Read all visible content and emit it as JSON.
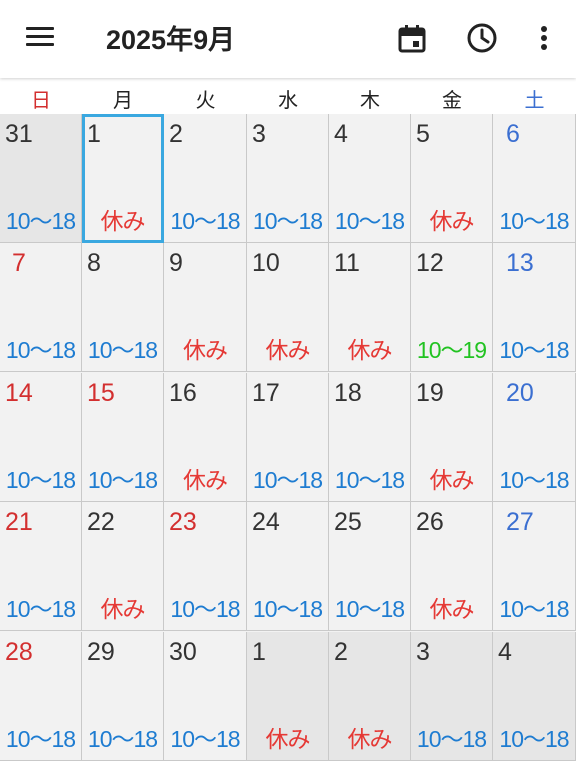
{
  "header": {
    "title": "2025年9月",
    "menu_icon": "hamburger-menu-icon",
    "actions": [
      "calendar-icon",
      "clock-icon",
      "more-vert-icon"
    ]
  },
  "weekdays": [
    "日",
    "月",
    "火",
    "水",
    "木",
    "金",
    "土"
  ],
  "colors": {
    "sunday": "#d32f2f",
    "saturday": "#3b6fd1",
    "work": "#1e7cd1",
    "holiday_text": "#e53935",
    "special": "#22c322",
    "default_day": "#333333",
    "other_month_bg": "#e6e6e6",
    "selected_border": "#3aa8e0"
  },
  "weeks": [
    [
      {
        "day": "31",
        "sched": "10〜18",
        "type": "work",
        "other": true
      },
      {
        "day": "1",
        "sched": "休み",
        "type": "off",
        "selected": true
      },
      {
        "day": "2",
        "sched": "10〜18",
        "type": "work"
      },
      {
        "day": "3",
        "sched": "10〜18",
        "type": "work"
      },
      {
        "day": "4",
        "sched": "10〜18",
        "type": "work"
      },
      {
        "day": "5",
        "sched": "休み",
        "type": "off"
      },
      {
        "day": "6",
        "sched": "10〜18",
        "type": "work"
      }
    ],
    [
      {
        "day": "7",
        "sched": "10〜18",
        "type": "work"
      },
      {
        "day": "8",
        "sched": "10〜18",
        "type": "work"
      },
      {
        "day": "9",
        "sched": "休み",
        "type": "off"
      },
      {
        "day": "10",
        "sched": "休み",
        "type": "off"
      },
      {
        "day": "11",
        "sched": "休み",
        "type": "off"
      },
      {
        "day": "12",
        "sched": "10〜19",
        "type": "special"
      },
      {
        "day": "13",
        "sched": "10〜18",
        "type": "work"
      }
    ],
    [
      {
        "day": "14",
        "sched": "10〜18",
        "type": "work"
      },
      {
        "day": "15",
        "sched": "10〜18",
        "type": "work",
        "holiday": true
      },
      {
        "day": "16",
        "sched": "休み",
        "type": "off"
      },
      {
        "day": "17",
        "sched": "10〜18",
        "type": "work"
      },
      {
        "day": "18",
        "sched": "10〜18",
        "type": "work"
      },
      {
        "day": "19",
        "sched": "休み",
        "type": "off"
      },
      {
        "day": "20",
        "sched": "10〜18",
        "type": "work"
      }
    ],
    [
      {
        "day": "21",
        "sched": "10〜18",
        "type": "work"
      },
      {
        "day": "22",
        "sched": "休み",
        "type": "off"
      },
      {
        "day": "23",
        "sched": "10〜18",
        "type": "work",
        "holiday": true
      },
      {
        "day": "24",
        "sched": "10〜18",
        "type": "work"
      },
      {
        "day": "25",
        "sched": "10〜18",
        "type": "work"
      },
      {
        "day": "26",
        "sched": "休み",
        "type": "off"
      },
      {
        "day": "27",
        "sched": "10〜18",
        "type": "work"
      }
    ],
    [
      {
        "day": "28",
        "sched": "10〜18",
        "type": "work"
      },
      {
        "day": "29",
        "sched": "10〜18",
        "type": "work"
      },
      {
        "day": "30",
        "sched": "10〜18",
        "type": "work"
      },
      {
        "day": "1",
        "sched": "休み",
        "type": "off",
        "other": true
      },
      {
        "day": "2",
        "sched": "休み",
        "type": "off",
        "other": true
      },
      {
        "day": "3",
        "sched": "10〜18",
        "type": "work",
        "other": true
      },
      {
        "day": "4",
        "sched": "10〜18",
        "type": "work",
        "other": true
      }
    ]
  ]
}
